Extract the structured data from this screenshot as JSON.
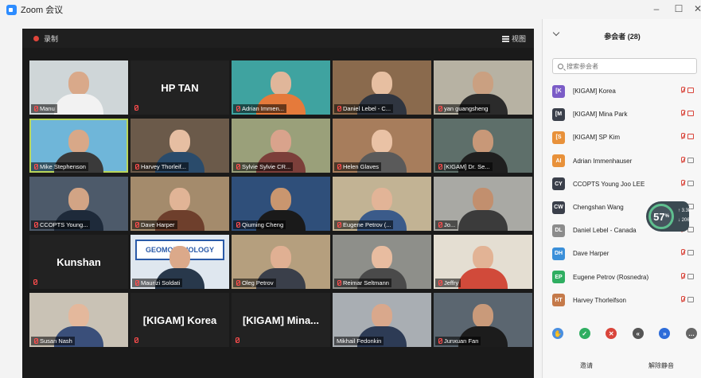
{
  "window": {
    "title": "Zoom 会议",
    "minimize": "–",
    "maximize": "☐",
    "close": "✕"
  },
  "topbar": {
    "recording_label": "录制",
    "view_label": "视图"
  },
  "tiles": [
    {
      "name": "Manu",
      "type": "video",
      "bg": "#cfd6d8",
      "skin": "#d9a98a",
      "shirt": "#f2f2f2"
    },
    {
      "name": "HP TAN",
      "type": "name"
    },
    {
      "name": "Adrian Immen...",
      "type": "video",
      "bg": "#3fa3a0",
      "skin": "#e0b69a",
      "shirt": "#e57a3b"
    },
    {
      "name": "Daniel Lebel - C...",
      "type": "video",
      "bg": "#8a6a4d",
      "skin": "#e7bfa1",
      "shirt": "#2f3540"
    },
    {
      "name": "yan guangsheng",
      "type": "video",
      "bg": "#b7b2a3",
      "skin": "#caa081",
      "shirt": "#2b2b2b"
    },
    {
      "name": "Mike Stephenson",
      "type": "video",
      "bg": "#6fb6d9",
      "skin": "#d8a888",
      "shirt": "#3a3a3a",
      "active": true
    },
    {
      "name": "Harvey Thorleif...",
      "type": "video",
      "bg": "#6b5a4a",
      "skin": "#e6bea2",
      "shirt": "#2a4b6b"
    },
    {
      "name": "Sylvie Sylvie CR...",
      "type": "video",
      "bg": "#9aa07a",
      "skin": "#d9a38c",
      "shirt": "#7c3f3a"
    },
    {
      "name": "Helen Glaves",
      "type": "video",
      "bg": "#a77d5c",
      "skin": "#eac2a5",
      "shirt": "#5a5a5a"
    },
    {
      "name": "[KIGAM] Dr. Se...",
      "type": "video",
      "bg": "#5e6f6a",
      "skin": "#c89878",
      "shirt": "#1f1f1f"
    },
    {
      "name": "CCOPTS Young...",
      "type": "video",
      "bg": "#4d5a6a",
      "skin": "#d2a485",
      "shirt": "#1e2a3a"
    },
    {
      "name": "Dave Harper",
      "type": "video",
      "bg": "#a48b6c",
      "skin": "#e1b496",
      "shirt": "#6e3f2c"
    },
    {
      "name": "Qiuming Cheng",
      "type": "video",
      "bg": "#2f4f7a",
      "skin": "#c9966f",
      "shirt": "#1a1a1a"
    },
    {
      "name": "Eugene Petrov (...",
      "type": "video",
      "bg": "#c2b394",
      "skin": "#e2b497",
      "shirt": "#3b5b8a"
    },
    {
      "name": "Jo...",
      "type": "video",
      "bg": "#a9a9a4",
      "skin": "#c28f6e",
      "shirt": "#3b3b3b"
    },
    {
      "name": "Kunshan",
      "type": "name"
    },
    {
      "name": "Maurizi Soldati",
      "type": "video",
      "bg": "#dfe7ef",
      "skin": "#dba98a",
      "shirt": "#28384b",
      "banner": "GEOMORPHOLOGY"
    },
    {
      "name": "Oleg Petrov",
      "type": "video",
      "bg": "#b59f7e",
      "skin": "#e0b093",
      "shirt": "#3a3f4a"
    },
    {
      "name": "Reimar Seltmann",
      "type": "video",
      "bg": "#8e8f8a",
      "skin": "#e8bca0",
      "shirt": "#4a4a4a"
    },
    {
      "name": "Jeffry",
      "type": "video",
      "bg": "#e4ded2",
      "skin": "#e2b395",
      "shirt": "#d14a3a"
    },
    {
      "name": "Susan Nash",
      "type": "video",
      "bg": "#c9c2b5",
      "skin": "#e4b89c",
      "shirt": "#3a4f7a"
    },
    {
      "name": "[KIGAM] Korea",
      "type": "name"
    },
    {
      "name": "[KIGAM] Mina...",
      "type": "name"
    },
    {
      "name": "Mikhail Fedonkin",
      "type": "video",
      "bg": "#a9aeb3",
      "skin": "#d9a88c",
      "shirt": "#2d3b55",
      "nomic": true
    },
    {
      "name": "Junxuan Fan",
      "type": "video",
      "bg": "#5b6670",
      "skin": "#c99a7a",
      "shirt": "#1c1c1c"
    }
  ],
  "panel": {
    "title": "参会者 (28)",
    "search_placeholder": "搜索参会者",
    "participants": [
      {
        "initials": "[K",
        "name": "[KIGAM] Korea",
        "color": "#7b5cc7",
        "cam_red": true
      },
      {
        "initials": "[M",
        "name": "[KIGAM] Mina Park",
        "color": "#3a3f4a",
        "cam_red": true
      },
      {
        "initials": "[S",
        "name": "[KIGAM] SP Kim",
        "color": "#e8913a",
        "cam_red": true
      },
      {
        "initials": "AI",
        "name": "Adrian Immenhauser",
        "color": "#e8913a",
        "cam_red": false
      },
      {
        "initials": "CY",
        "name": "CCOPTS Young Joo LEE",
        "color": "#3a3f4a",
        "cam_red": false
      },
      {
        "initials": "CW",
        "name": "Chengshan Wang",
        "color": "#3a3f4a",
        "cam_red": false
      },
      {
        "initials": "DL",
        "name": "Daniel Lebel - Canada",
        "color": "#8c8c8c",
        "cam_red": false
      },
      {
        "initials": "DH",
        "name": "Dave Harper",
        "color": "#3b8fd9",
        "cam_red": false
      },
      {
        "initials": "EP",
        "name": "Eugene Petrov (Rosnedra)",
        "color": "#2fae61",
        "cam_red": false
      },
      {
        "initials": "HT",
        "name": "Harvey Thorleifson",
        "color": "#c57a4a",
        "cam_red": false
      }
    ],
    "gauge": {
      "value": "57",
      "unit": "%",
      "up": "3.3k",
      "down": "206"
    },
    "reactions": [
      {
        "icon": "hand-icon",
        "symbol": "✋",
        "color": "#4a8fe0"
      },
      {
        "icon": "yes-icon",
        "symbol": "✓",
        "color": "#2fae61"
      },
      {
        "icon": "no-icon",
        "symbol": "✕",
        "color": "#d9453b"
      },
      {
        "icon": "slower-icon",
        "symbol": "«",
        "color": "#555555"
      },
      {
        "icon": "faster-icon",
        "symbol": "»",
        "color": "#2d6cd9"
      },
      {
        "icon": "more-icon",
        "symbol": "…",
        "color": "#666666"
      }
    ],
    "invite_label": "邀请",
    "unmute_all_label": "解除静音"
  }
}
